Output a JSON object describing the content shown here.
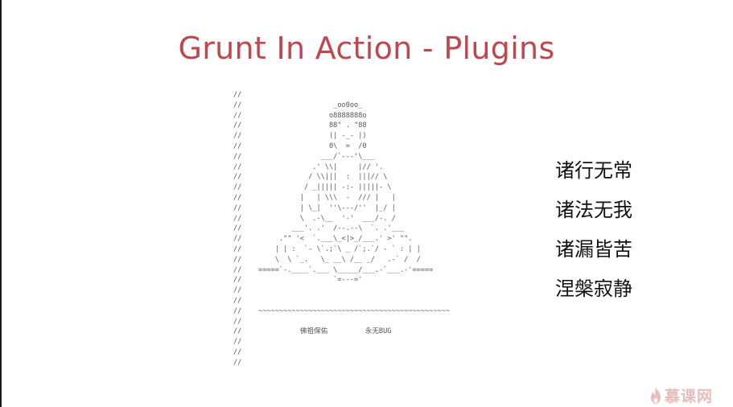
{
  "title": "Grunt In Action - Plugins",
  "code_lines": [
    "//",
    "//                      _oo0oo_",
    "//                     o8888888o",
    "//                     88\" . \"88",
    "//                     (| -_- |)",
    "//                     0\\  =  /0",
    "//                   ___/`---'\\___",
    "//                 .' \\\\|     |// '.",
    "//                / \\\\|||  :  |||// \\",
    "//               / _||||| -:- |||||- \\",
    "//              |   | \\\\\\  -  /// |   |",
    "//              | \\_|  ''\\---/''  |_/ |",
    "//              \\  .-\\__  '-'  ___/-. /",
    "//            ___'. .'  /--.--\\  `. .'___",
    "//         .\"\" '<  `.___\\_<|>_/___.' >' \"\".",
    "//        | | :  `- \\`.;`\\ _ /`;.`/ - ` : | |",
    "//        \\  \\ `_.   \\_ __\\ /__ _/   .-` /  /",
    "//    =====`-.____`.___ \\_____/___.-`___.-'=====",
    "//                      `=---='",
    "//",
    "//",
    "//    ~~~~~~~~~~~~~~~~~~~~~~~~~~~~~~~~~~~~~~~~~~~~~~",
    "//",
    "//              佛祖保佑         永无BUG",
    "//",
    "//",
    "//"
  ],
  "mantras": [
    "诸行无常",
    "诸法无我",
    "诸漏皆苦",
    "涅槃寂静"
  ],
  "logo": {
    "text": "慕课网",
    "icon": "flame-icon",
    "color": "#e8bcbc"
  },
  "colors": {
    "title": "#c0474e",
    "code": "#555555"
  }
}
